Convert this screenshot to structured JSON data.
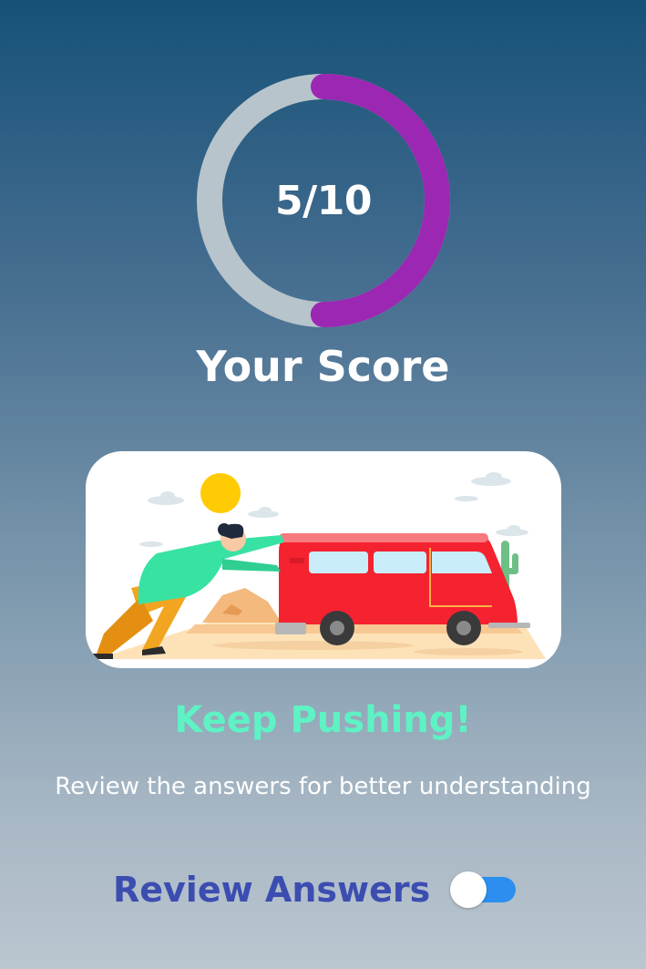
{
  "score": {
    "value": "5/10",
    "correct": 5,
    "total": 10,
    "progress_fraction": 0.5,
    "ring_color": "#9b27b3",
    "track_color": "#b7c4cb"
  },
  "title": "Your Score",
  "illustration": {
    "icon": "person-pushing-red-van-illustration"
  },
  "feedback": {
    "headline": "Keep Pushing!",
    "message": "Review the answers for better understanding",
    "headline_color": "#5ef2c4"
  },
  "review": {
    "label": "Review Answers",
    "toggle_state": "off",
    "label_color": "#3c4db1",
    "toggle_color": "#2c8ff0"
  }
}
